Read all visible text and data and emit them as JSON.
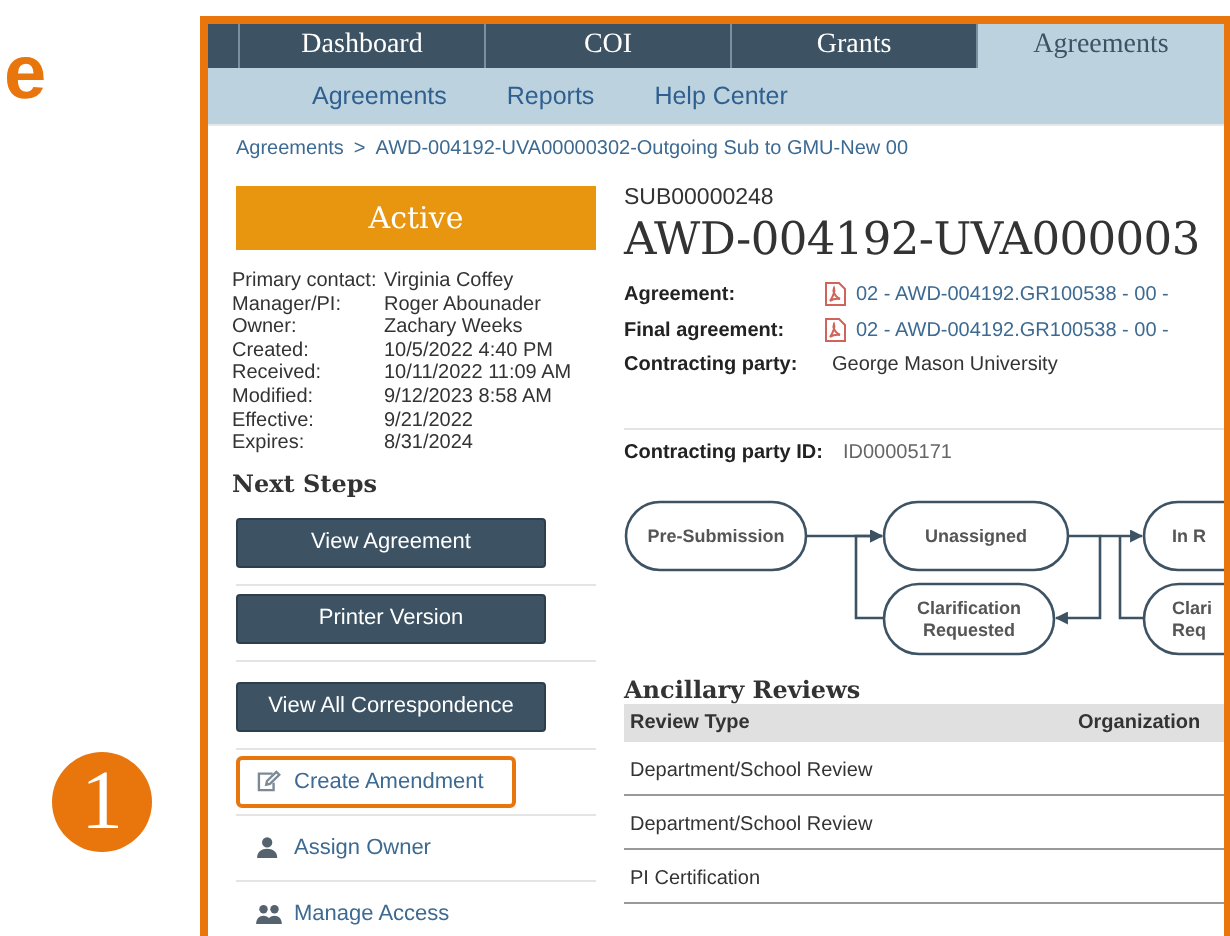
{
  "annotation": {
    "letter": "e",
    "step_number": "1"
  },
  "nav": {
    "tabs": [
      {
        "label": "Dashboard",
        "selected": false
      },
      {
        "label": "COI",
        "selected": false
      },
      {
        "label": "Grants",
        "selected": false
      },
      {
        "label": "Agreements",
        "selected": true
      }
    ]
  },
  "subnav": [
    "Agreements",
    "Reports",
    "Help Center"
  ],
  "breadcrumb": {
    "parent": "Agreements",
    "separator": ">",
    "current": "AWD-004192-UVA00000302-Outgoing Sub to GMU-New 00"
  },
  "status": "Active",
  "details": [
    {
      "label": "Primary contact:",
      "value": "Virginia Coffey"
    },
    {
      "label": "Manager/PI:",
      "value": "Roger Abounader"
    },
    {
      "label": "Owner:",
      "value": "Zachary Weeks"
    },
    {
      "label": "Created:",
      "value": "10/5/2022 4:40 PM"
    },
    {
      "label": "Received:",
      "value": "10/11/2022 11:09 AM"
    },
    {
      "label": "Modified:",
      "value": "9/12/2023 8:58 AM"
    },
    {
      "label": "Effective:",
      "value": "9/21/2022"
    },
    {
      "label": "Expires:",
      "value": "8/31/2024"
    }
  ],
  "next_steps": {
    "title": "Next Steps",
    "buttons": [
      "View Agreement",
      "Printer Version",
      "View All Correspondence"
    ],
    "actions": [
      {
        "label": "Create Amendment",
        "kind": "edit",
        "highlighted": true
      },
      {
        "label": "Assign Owner",
        "kind": "person",
        "highlighted": false
      },
      {
        "label": "Manage Access",
        "kind": "people",
        "highlighted": false
      }
    ]
  },
  "record": {
    "id": "SUB00000248",
    "title": "AWD-004192-UVA000003",
    "fields": [
      {
        "label": "Agreement:",
        "value": "02 - AWD-004192.GR100538 - 00 -",
        "kind": "file"
      },
      {
        "label": "Final agreement:",
        "value": "02 - AWD-004192.GR100538 - 00 -",
        "kind": "file"
      },
      {
        "label": "Contracting party:",
        "value": "George Mason University",
        "kind": "text"
      }
    ],
    "party_id": {
      "label": "Contracting party ID:",
      "value": "ID00005171"
    }
  },
  "workflow": {
    "nodes": [
      {
        "label": "Pre-Submission"
      },
      {
        "label": "Unassigned"
      },
      {
        "label": "Clarification\nRequested"
      },
      {
        "label": "In R"
      },
      {
        "label": "Clari\nReq"
      }
    ]
  },
  "ancillary_reviews": {
    "title": "Ancillary Reviews",
    "columns": [
      "Review Type",
      "Organization"
    ],
    "rows": [
      [
        "Department/School Review"
      ],
      [
        "Department/School Review"
      ],
      [
        "PI Certification"
      ]
    ]
  }
}
